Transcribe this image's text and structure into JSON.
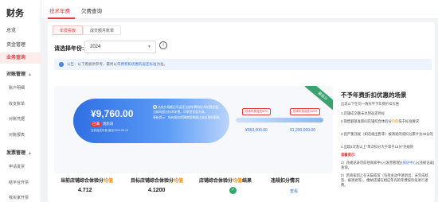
{
  "sidebar": {
    "title": "财务",
    "items": [
      {
        "label": "总览",
        "type": "top"
      },
      {
        "label": "资金管理",
        "type": "top"
      },
      {
        "label": "业务查询",
        "type": "active"
      },
      {
        "label": "对账管理",
        "type": "group"
      },
      {
        "label": "账户明细",
        "type": "sub"
      },
      {
        "label": "收支账单",
        "type": "sub"
      },
      {
        "label": "对账凭据",
        "type": "sub"
      },
      {
        "label": "对账报表",
        "type": "sub"
      },
      {
        "label": "发票管理",
        "type": "group"
      },
      {
        "label": "申请发票",
        "type": "sub"
      },
      {
        "label": "结平台开票",
        "type": "sub"
      },
      {
        "label": "我买家开票",
        "type": "sub"
      }
    ]
  },
  "top_tabs": [
    {
      "label": "技术年费",
      "active": true
    },
    {
      "label": "欠费查询",
      "active": false
    }
  ],
  "sub_tabs": [
    {
      "label": "年费看板",
      "active": true
    },
    {
      "label": "成交额月账单",
      "active": false
    }
  ],
  "year_filter": {
    "label": "请选择年份:",
    "value": "2024"
  },
  "notice": {
    "prefix": "公告：以下看板供参考，最终以",
    "link": "年费积扣优惠的返还标准",
    "suffix": "为准。"
  },
  "hero": {
    "amount": "¥9,760.00",
    "badge_tag": "已满",
    "badge_text": "现阶段",
    "date_text": "当前返还年费 截至2024-09-19",
    "desc_line1": "达成交易额后可返还全部年费的技术年费优惠，当前的超出技术年费，可享受优惠大体。",
    "desc_line2": "更新提示：所有服务保障商家数据达成交易时更新。",
    "ribbon": "最低分",
    "tip1": "技术年费返还50%",
    "tip2": "技术年费返还100%",
    "val1": "¥360,000.00",
    "val2": "¥1,200,000.00"
  },
  "stats": [
    {
      "title_pre": "当前店铺综合体验分",
      "title_hl": "均值",
      "value": "4.712"
    },
    {
      "title_pre": "目标店铺综合体验分",
      "title_hl": "均值",
      "value": "4.1200"
    },
    {
      "title_pre": "店铺综合体验分",
      "title_hl": "均值",
      "title_post": "结果",
      "value": "✓"
    },
    {
      "title_pre": "违规扣分情况",
      "title_hl": "",
      "value": "查看"
    }
  ],
  "right_panel": {
    "title": "不予年费折扣优惠的场景",
    "sub": "出现以下任何一情形不予年费折扣优惠",
    "lines": [
      {
        "text": "1.店铺成交额未达到返还目标"
      },
      {
        "pre": "2.销售额基准期间店铺综合体验分",
        "hl": "均值",
        "post": "低于标准要求"
      },
      {
        "text": "3.因严重违规（如违规出售等）被清退的或扣分累计达48分的"
      },
      {
        "text": "4.出现2次及以上\"单次扣分大于等于12分\"违规的"
      },
      {
        "red": "温馨提示:"
      },
      {
        "pre": "1）违规记录可前往商家中心-[发营管理]-[",
        "blue": "保证中心",
        "post": "]-[违规记录]查询。"
      },
      {
        "text": "2）若商家因上在天猫或贸（包括主动申请退出、未完成续签、被清退等），缴纳店铺在相应年内的年费按阶段进行退费。"
      }
    ]
  }
}
